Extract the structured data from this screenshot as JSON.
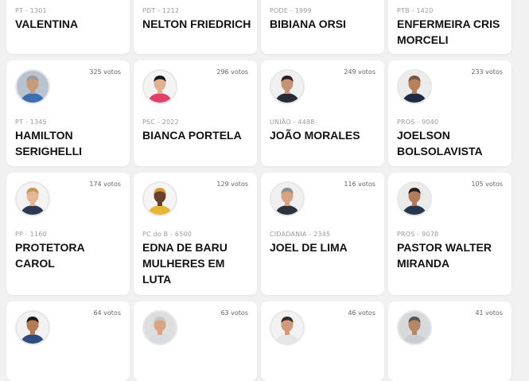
{
  "candidates": [
    {
      "party": "PT - 1301",
      "name": "VALENTINA",
      "votes": ""
    },
    {
      "party": "PDT - 1212",
      "name": "NELTON FRIEDRICH",
      "votes": ""
    },
    {
      "party": "PODE - 1999",
      "name": "BIBIANA ORSI",
      "votes": ""
    },
    {
      "party": "PTB - 1420",
      "name": "ENFERMEIRA CRIS MORCELI",
      "votes": ""
    },
    {
      "party": "PT - 1345",
      "name": "HAMILTON SERIGHELLI",
      "votes": "325 votos",
      "avatar": {
        "skin": "#c99a7a",
        "hair": "#9b9b9b",
        "shirt": "#3d6fb0",
        "bg": "#b8c3cf"
      }
    },
    {
      "party": "PSC - 2022",
      "name": "BIANCA PORTELA",
      "votes": "296 votos",
      "avatar": {
        "skin": "#e2b193",
        "hair": "#1b1212",
        "shirt": "#e0406a",
        "bg": "#f4f4f4"
      }
    },
    {
      "party": "UNIÃO - 4488",
      "name": "JOÃO MORALES",
      "votes": "249 votos",
      "avatar": {
        "skin": "#c79273",
        "hair": "#2b211c",
        "shirt": "#262b37",
        "bg": "#f0f0f0"
      }
    },
    {
      "party": "PROS - 9040",
      "name": "JOELSON BOLSOLAVISTA",
      "votes": "233 votos",
      "avatar": {
        "skin": "#b7805d",
        "hair": "#7a5340",
        "shirt": "#1d2c44",
        "bg": "#ececec"
      }
    },
    {
      "party": "PP - 1160",
      "name": "PROTETORA CAROL",
      "votes": "174 votos",
      "avatar": {
        "skin": "#e4b896",
        "hair": "#c6924e",
        "shirt": "#2d3a52",
        "bg": "#f3f3f3"
      }
    },
    {
      "party": "PC do B - 6500",
      "name": "EDNA DE BARU MULHERES EM LUTA",
      "votes": "129 votos",
      "avatar": {
        "skin": "#6a402a",
        "hair": "#d49b3f",
        "shirt": "#e6b733",
        "bg": "#f5f5f5"
      }
    },
    {
      "party": "CIDADANIA - 2345",
      "name": "JOEL DE LIMA",
      "votes": "116 votos",
      "avatar": {
        "skin": "#d7a283",
        "hair": "#8d8d8d",
        "shirt": "#2f3340",
        "bg": "#f0f0f0"
      }
    },
    {
      "party": "PROS - 9078",
      "name": "PASTOR WALTER MIRANDA",
      "votes": "105 votos",
      "avatar": {
        "skin": "#b27d5c",
        "hair": "#2a1d16",
        "shirt": "#27364f",
        "bg": "#ebebeb"
      }
    },
    {
      "party": "",
      "name": "",
      "votes": "64 votos",
      "avatar": {
        "skin": "#b27a55",
        "hair": "#1e1612",
        "shirt": "#2f4c82",
        "bg": "#f2f2f2"
      }
    },
    {
      "party": "",
      "name": "",
      "votes": "63 votos",
      "avatar": {
        "skin": "#d9a583",
        "hair": "#c8c8c8",
        "shirt": "#d8dbe0",
        "bg": "#dedede"
      }
    },
    {
      "party": "",
      "name": "",
      "votes": "46 votos",
      "avatar": {
        "skin": "#cf9b79",
        "hair": "#3a2a22",
        "shirt": "#e5e5e5",
        "bg": "#f2f2f2"
      }
    },
    {
      "party": "",
      "name": "",
      "votes": "41 votos",
      "avatar": {
        "skin": "#b78664",
        "hair": "#555555",
        "shirt": "#c9ccd1",
        "bg": "#d7d9db"
      }
    }
  ]
}
